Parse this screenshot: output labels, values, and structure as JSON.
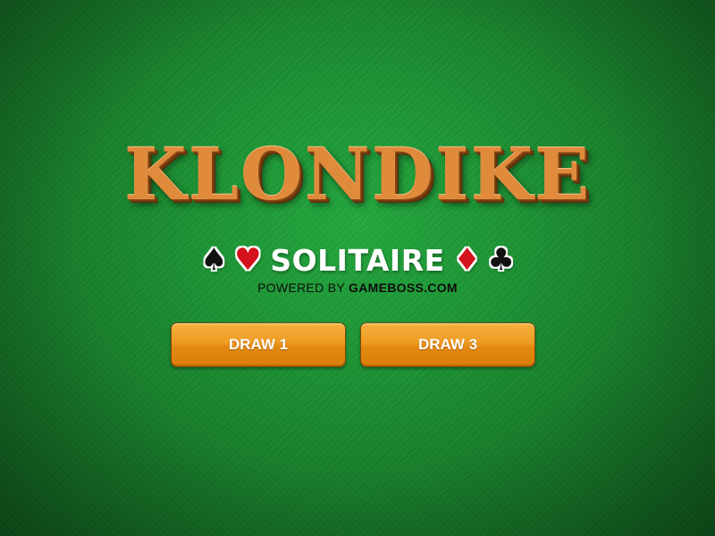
{
  "title": "KLONDIKE",
  "subtitle": {
    "text": "SOLITAIRE",
    "suits_left": [
      "♠",
      "♥"
    ],
    "suits_right": [
      "♦",
      "♣"
    ]
  },
  "powered_by": {
    "prefix": "POWERED BY",
    "brand": "GAMEBOSS.COM"
  },
  "buttons": {
    "draw1_label": "DRAW 1",
    "draw3_label": "DRAW 3"
  },
  "colors": {
    "felt": "#1c9534",
    "title": "#e08a3c",
    "button": "#ee9b22",
    "suit_red": "#d4121c",
    "suit_black": "#111111"
  },
  "icons": [
    "spade-icon",
    "heart-icon",
    "diamond-icon",
    "club-icon"
  ]
}
